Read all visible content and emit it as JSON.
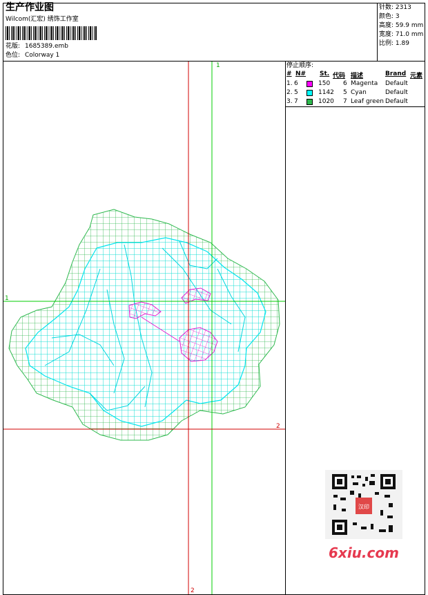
{
  "header": {
    "title": "生产作业图",
    "studio": "Wilcom(汇宏) 绣饰工作室",
    "design_label": "花版:",
    "design_file": "1685389.emb",
    "colorway_label": "色位:",
    "colorway_value": "Colorway 1"
  },
  "stats": {
    "stitches_label": "针数:",
    "stitches_value": "2313",
    "colors_label": "颜色:",
    "colors_value": "3",
    "height_label": "高度:",
    "height_value": "59.9 mm",
    "width_label": "宽度:",
    "width_value": "71.0 mm",
    "scale_label": "比例:",
    "scale_value": "1.89"
  },
  "sequence": {
    "title": "停止顺序:",
    "headers": [
      "#",
      "N#",
      "St.",
      "代码",
      "描述",
      "Brand",
      "元素"
    ],
    "rows": [
      {
        "index": "1.",
        "needle": "6",
        "color": "#ff00ff",
        "stitches": "150",
        "code": "6",
        "description": "Magenta",
        "brand": "Default"
      },
      {
        "index": "2.",
        "needle": "5",
        "color": "#00ffff",
        "stitches": "1142",
        "code": "5",
        "description": "Cyan",
        "brand": "Default"
      },
      {
        "index": "3.",
        "needle": "7",
        "color": "#2db84d",
        "stitches": "1020",
        "code": "7",
        "description": "Leaf green",
        "brand": "Default"
      }
    ]
  },
  "axis_markers": {
    "green_vertical": "1",
    "green_horizontal": "1",
    "red_vertical": "2",
    "red_horizontal": "2"
  },
  "colors": {
    "green": "#2db84d",
    "cyan": "#00e5ee",
    "magenta": "#e020d0",
    "red_axis": "#d00000",
    "green_axis": "#00cc00"
  },
  "watermark": {
    "qr_badge": "汉印",
    "site": "6xiu.com"
  }
}
